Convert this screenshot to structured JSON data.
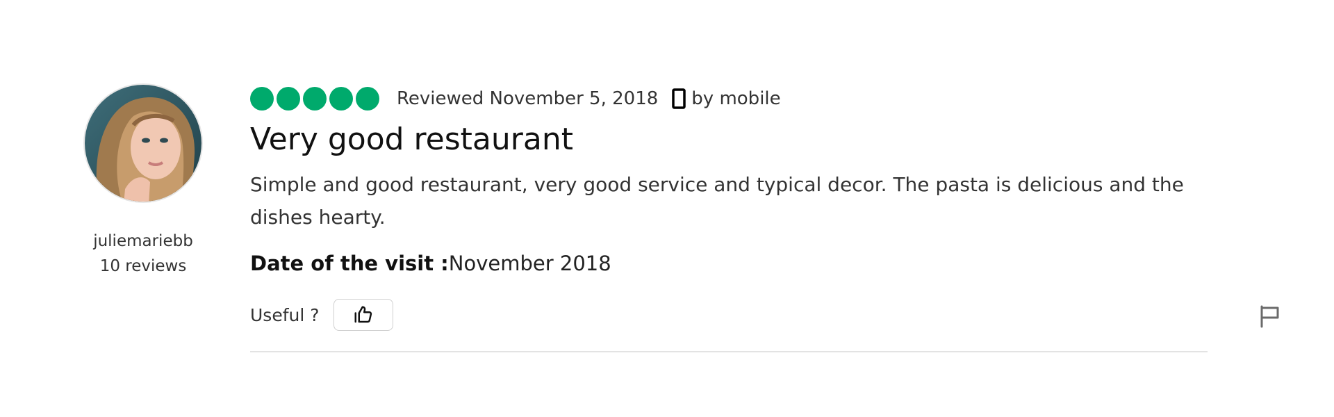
{
  "review": {
    "author": {
      "username": "juliemariebb",
      "reviews_count": "10 reviews"
    },
    "rating": {
      "value": 5,
      "max": 5
    },
    "reviewed_date": "Reviewed November 5, 2018",
    "via": "by mobile",
    "title": "Very good restaurant",
    "text": "Simple and good restaurant, very good service and typical decor. The pasta is delicious and the dishes hearty.",
    "visit": {
      "label": "Date of the visit :",
      "value": "November 2018"
    },
    "useful_label": "Useful ?"
  },
  "icons": {
    "mobile": "mobile-phone-icon",
    "thumb": "thumbs-up-icon",
    "flag": "flag-icon"
  },
  "colors": {
    "rating": "#00aa6c",
    "divider": "#e3e3e3"
  }
}
